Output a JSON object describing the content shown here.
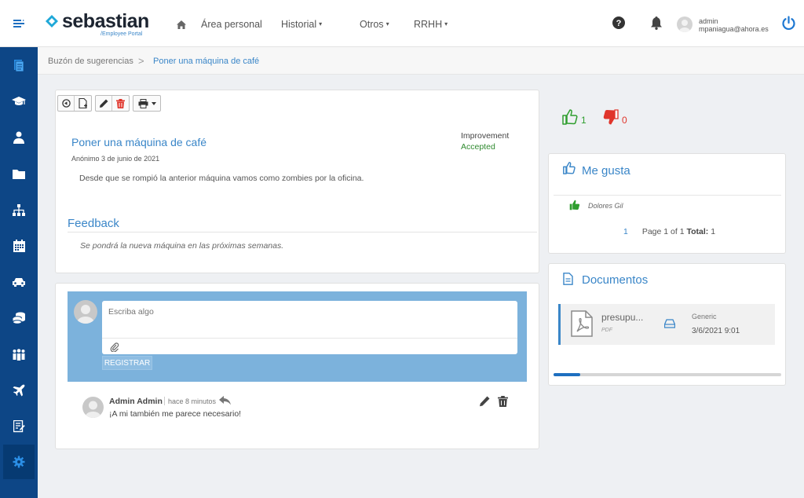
{
  "app": {
    "logo": "sebastian",
    "logo_subtitle": "/Employee Portal"
  },
  "nav": {
    "items": [
      {
        "label": "Área personal"
      },
      {
        "label": "Historial",
        "caret": "▾"
      },
      {
        "label": "Otros",
        "caret": "▾"
      },
      {
        "label": "RRHH",
        "caret": "▾"
      }
    ]
  },
  "user": {
    "role": "admin",
    "email": "mpaniagua@ahora.es"
  },
  "breadcrumb": {
    "parent": "Buzón de sugerencias",
    "separator": ">",
    "current": "Poner una máquina de café"
  },
  "suggestion": {
    "title": "Poner una máquina de café",
    "author": "Anónimo",
    "date": "3 de junio de 2021",
    "type": "Improvement",
    "status": "Accepted",
    "body": "Desde que se rompió la anterior máquina vamos como zombies por la oficina.",
    "status_color": "#2f8a2f"
  },
  "feedback": {
    "title": "Feedback",
    "text": "Se pondrá la nueva máquina en las próximas semanas."
  },
  "composer": {
    "placeholder": "Escriba algo",
    "submit_label": "REGISTRAR"
  },
  "comments": [
    {
      "author": "Admin Admin",
      "time": "hace 8 minutos",
      "text": "¡A mi también me parece necesario!"
    }
  ],
  "votes": {
    "up": "1",
    "down": "0",
    "up_color": "#2e9e2e",
    "down_color": "#e0352b"
  },
  "likes": {
    "title": "Me gusta",
    "users": [
      "Dolores Gil"
    ],
    "page": "1",
    "page_info": "Page 1 of 1",
    "total_label": "Total:",
    "total": "1"
  },
  "documents": {
    "title": "Documentos",
    "items": [
      {
        "name": "presupu...",
        "type": "PDF",
        "category": "Generic",
        "date": "3/6/2021 9:01"
      }
    ]
  },
  "icons": {
    "sidebar": [
      "document-icon",
      "graduation-cap-icon",
      "user-icon",
      "folder-icon",
      "org-chart-icon",
      "calendar-icon",
      "car-icon",
      "coins-icon",
      "team-icon",
      "plane-icon",
      "form-icon",
      "settings-gear-icon"
    ],
    "accent": "#3a86c8",
    "sidebar_bg": "#0d4686"
  }
}
